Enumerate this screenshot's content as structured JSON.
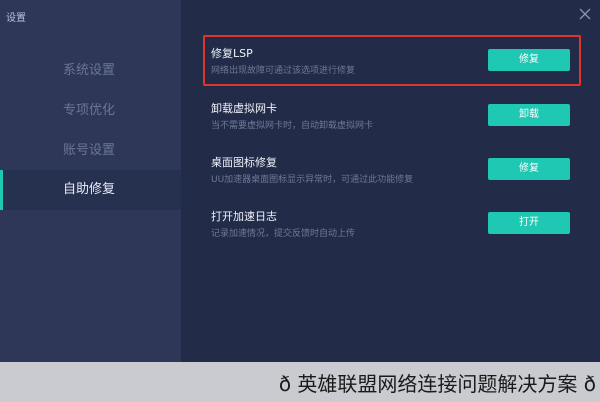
{
  "window": {
    "title": "设置",
    "close_icon": "close-icon"
  },
  "sidebar": {
    "items": [
      {
        "label": "系统设置",
        "active": false
      },
      {
        "label": "专项优化",
        "active": false
      },
      {
        "label": "账号设置",
        "active": false
      },
      {
        "label": "自助修复",
        "active": true
      }
    ]
  },
  "settings": {
    "rows": [
      {
        "title": "修复LSP",
        "desc": "网络出现故障可通过该选项进行修复",
        "button": "修复",
        "highlighted": true
      },
      {
        "title": "卸载虚拟网卡",
        "desc": "当不需要虚拟网卡时，自动卸载虚拟网卡",
        "button": "卸载",
        "highlighted": false
      },
      {
        "title": "桌面图标修复",
        "desc": "UU加速器桌面图标显示异常时，可通过此功能修复",
        "button": "修复",
        "highlighted": false
      },
      {
        "title": "打开加速日志",
        "desc": "记录加速情况，提交反馈时自动上传",
        "button": "打开",
        "highlighted": false
      }
    ]
  },
  "caption": {
    "text": "ð 英雄联盟网络连接问题解决方案 ð"
  },
  "colors": {
    "accent": "#1ec8b2",
    "highlight_border": "#e3342b",
    "sidebar_bg": "#2e3758",
    "content_bg": "#222b47"
  }
}
